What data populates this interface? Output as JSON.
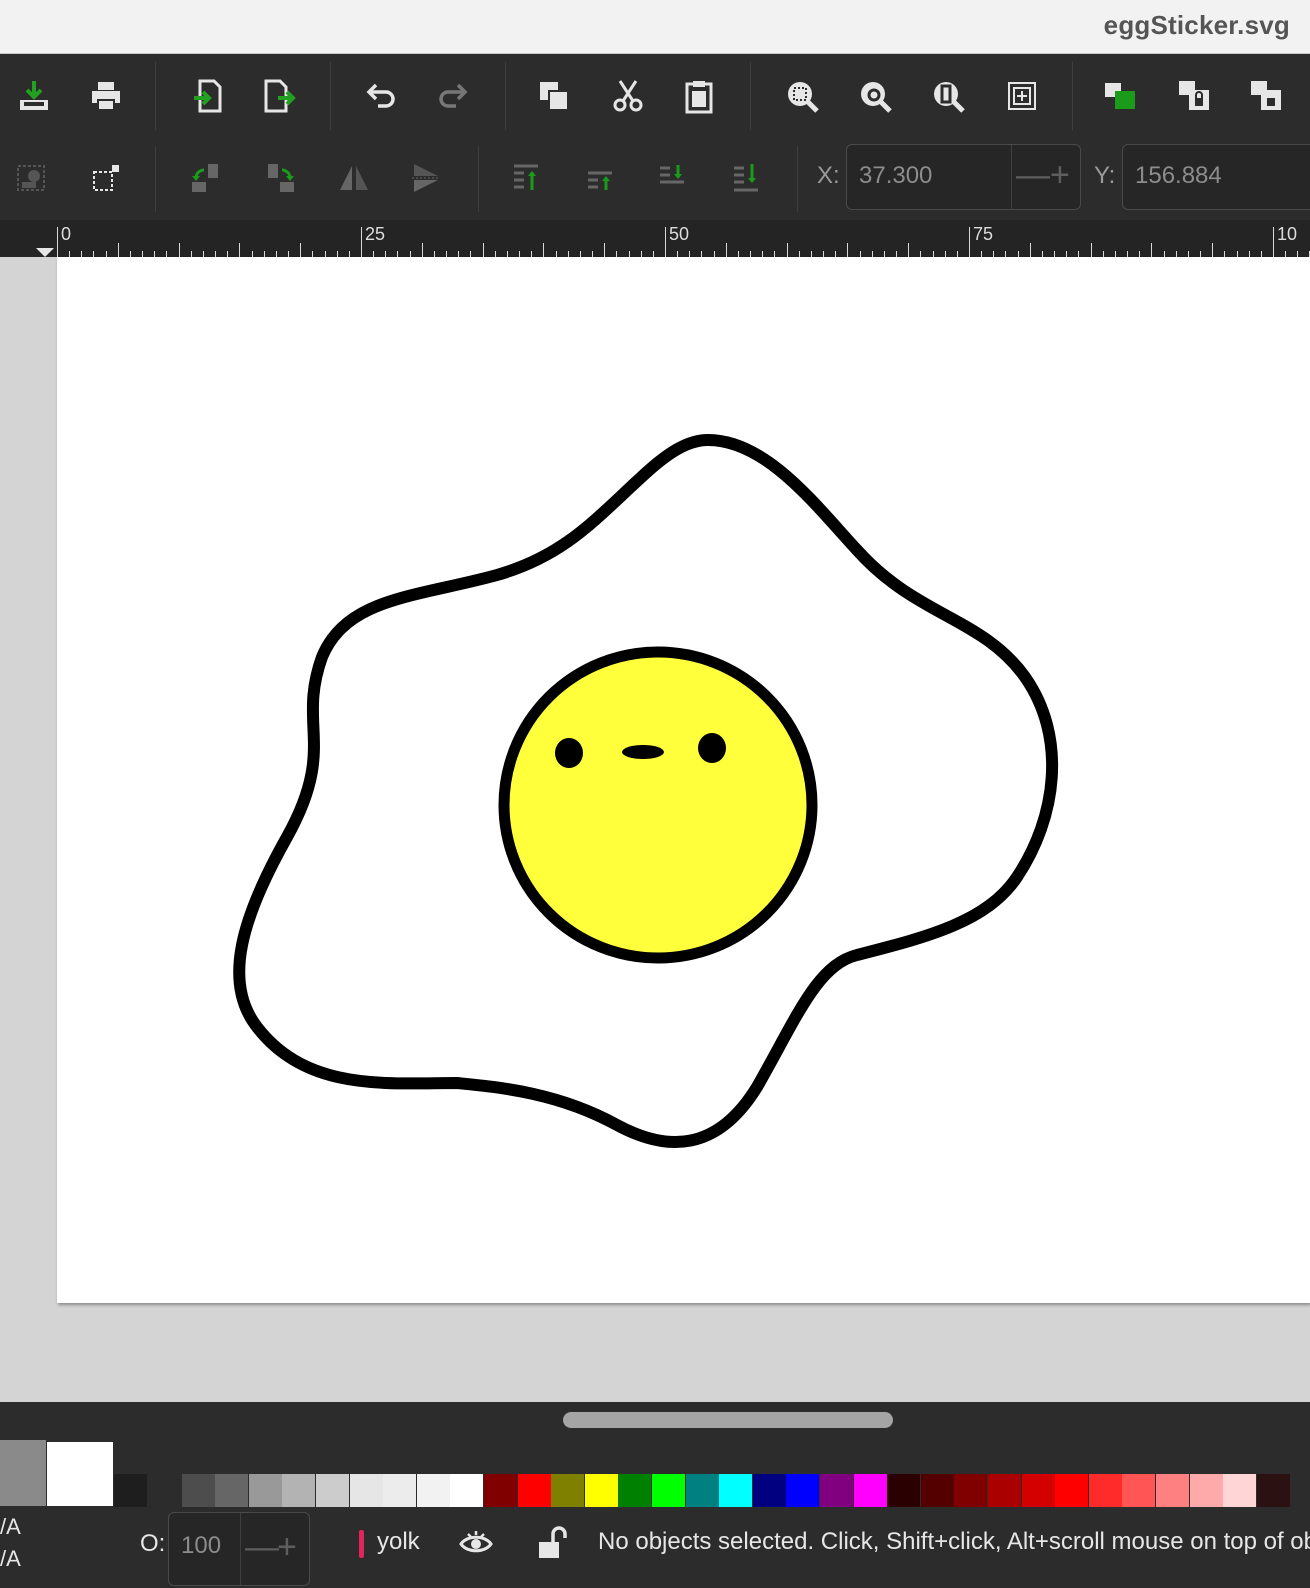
{
  "window": {
    "title": "eggSticker.svg"
  },
  "toolbar": {
    "x_label": "X:",
    "x_value": "37.300",
    "y_label": "Y:",
    "y_value": "156.884",
    "minus": "—",
    "plus": "+"
  },
  "ruler": {
    "labels": [
      "0",
      "25",
      "50",
      "75",
      "10"
    ]
  },
  "canvas": {
    "colors": {
      "yolk_fill": "#ffff3c",
      "outline": "#000000",
      "white_fill": "#ffffff"
    }
  },
  "palette": {
    "fill_indicator": "#8a8a8a",
    "stroke_indicator": "#ffffff",
    "colors": [
      "#1e1e1e",
      "#2c2c2c",
      "#4d4d4d",
      "#666666",
      "#999999",
      "#b3b3b3",
      "#cccccc",
      "#e6e6e6",
      "#ececec",
      "#f2f2f2",
      "#ffffff",
      "#800000",
      "#ff0000",
      "#808000",
      "#ffff00",
      "#008000",
      "#00ff00",
      "#008080",
      "#00ffff",
      "#000080",
      "#0000ff",
      "#800080",
      "#ff00ff",
      "#2b0000",
      "#550000",
      "#800000",
      "#aa0000",
      "#d40000",
      "#ff0000",
      "#ff2a2a",
      "#ff5555",
      "#ff8080",
      "#ffaaaa",
      "#ffd5d5",
      "#2b1111"
    ]
  },
  "status": {
    "fill_na": "/A",
    "stroke_na": "/A",
    "opacity_label": "O:",
    "opacity_value": "100",
    "minus": "—",
    "plus": "+",
    "layer_name": "yolk",
    "message": "No objects selected. Click, Shift+click, Alt+scroll mouse on top of objects"
  }
}
